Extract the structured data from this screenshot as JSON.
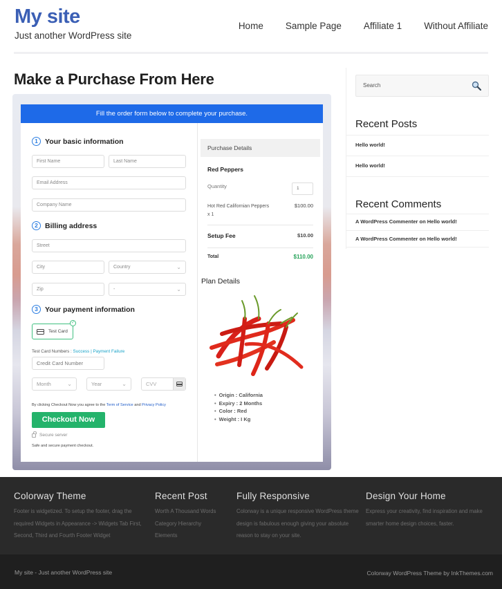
{
  "header": {
    "site_title": "My site",
    "tagline": "Just another WordPress site",
    "nav": [
      "Home",
      "Sample Page",
      "Affiliate 1",
      "Without Affiliate"
    ]
  },
  "main": {
    "title": "Make a Purchase From Here",
    "banner": "Fill the order form below to complete your purchase.",
    "steps": [
      {
        "num": "1",
        "label": "Your basic information"
      },
      {
        "num": "2",
        "label": "Billing address"
      },
      {
        "num": "3",
        "label": "Your payment information"
      }
    ],
    "fields": {
      "first_name": "First Name",
      "last_name": "Last Name",
      "email": "Email Address",
      "company": "Company Name",
      "street": "Street",
      "city": "City",
      "country": "Country",
      "zip": "Zip",
      "state": "-",
      "card_number": "Credit Card Number",
      "month": "Month",
      "year": "Year",
      "cvv": "CVV"
    },
    "payment_method": "Test Card",
    "test_numbers_label": "Test Card Numbers :",
    "test_success": "Success",
    "test_separator": "|",
    "test_failure": "Payment Failure",
    "agree_prefix": "By clicking Checkout Now you agree to the",
    "terms_link": "Term of Service",
    "agree_and": "and",
    "privacy_link": "Privacy Policy",
    "checkout_label": "Checkout Now",
    "secure_label": "Secure server",
    "safe_label": "Safe and secure payment checkout."
  },
  "purchase": {
    "heading": "Purchase Details",
    "product": "Red Peppers",
    "quantity_label": "Quantity",
    "quantity_value": "1",
    "item_label": "Hot Red Californian Peppers x 1",
    "item_price": "$100.00",
    "fee_label": "Setup Fee",
    "fee_price": "$10.00",
    "total_label": "Total",
    "total_price": "$110.00",
    "total_color": "#27a35a"
  },
  "plan": {
    "heading": "Plan Details",
    "image": "red-chili-peppers",
    "details": [
      "Origin : California",
      "Expiry : 2 Months",
      "Color : Red",
      "Weight : I Kg"
    ]
  },
  "sidebar": {
    "search_placeholder": "Search",
    "recent_posts_title": "Recent Posts",
    "recent_posts": [
      "Hello world!",
      "Hello world!"
    ],
    "recent_comments_title": "Recent Comments",
    "recent_comments": [
      "A WordPress Commenter on Hello world!",
      "A WordPress Commenter on Hello world!"
    ]
  },
  "footer": {
    "columns": [
      {
        "title": "Colorway Theme",
        "text": "Footer is widgetized. To setup the footer, drag the required Widgets in Appearance -> Widgets Tab First, Second, Third and Fourth Footer Widget"
      },
      {
        "title": "Recent Post",
        "items": [
          "Worth A Thousand Words",
          "Category Hierarchy",
          "Elements"
        ]
      },
      {
        "title": "Fully Responsive",
        "text": "Colorway is a unique responsive WordPress theme design is fabulous enough giving your absolute reason to stay on your site."
      },
      {
        "title": "Design Your Home",
        "text": "Express your creativity, find inspiration and make smarter home design choices, faster."
      }
    ],
    "bottom_left": "My site - Just another WordPress site",
    "bottom_right": "Colorway WordPress Theme by InkThemes.com"
  },
  "colors": {
    "brand": "#3b5fb5",
    "banner": "#1e6ae8",
    "checkout": "#24b36b",
    "footer": "#2a2a2a"
  }
}
